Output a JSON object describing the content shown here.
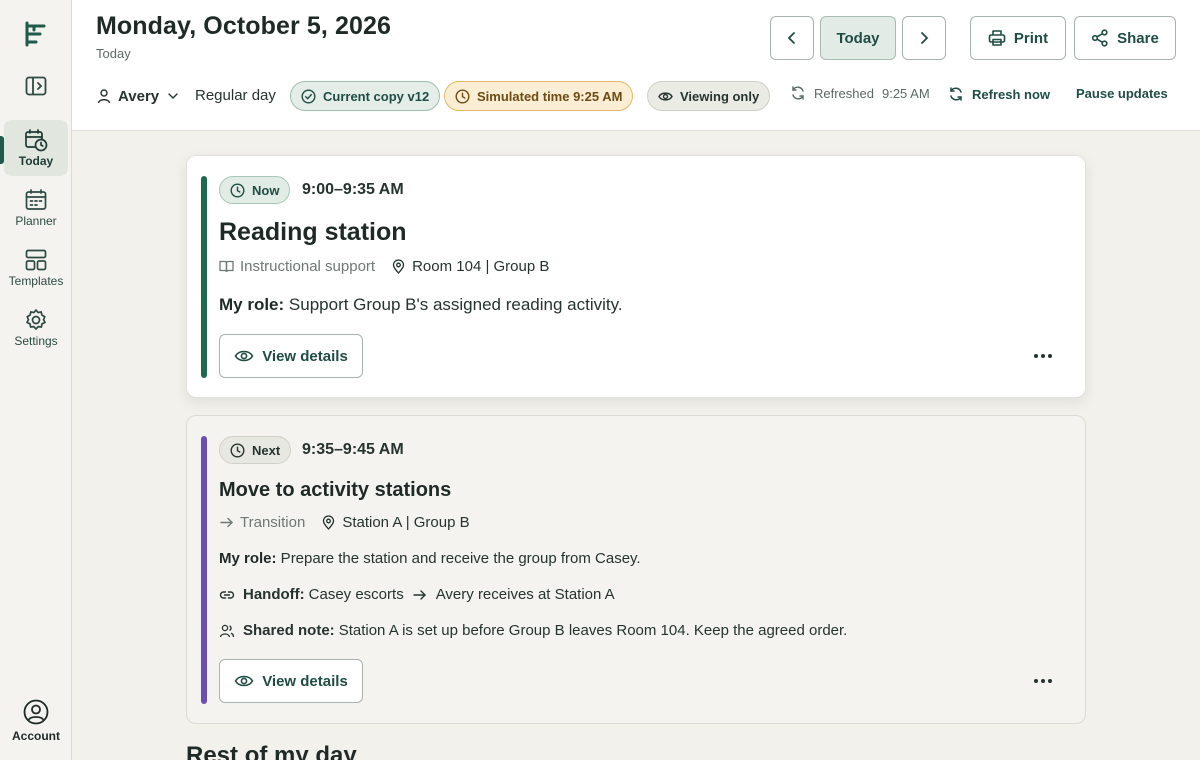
{
  "sidebar": {
    "items": [
      {
        "label": "Today",
        "icon": "calendar-clock-icon"
      },
      {
        "label": "Planner",
        "icon": "calendar-icon"
      },
      {
        "label": "Templates",
        "icon": "layout-icon"
      },
      {
        "label": "Settings",
        "icon": "gear-icon"
      }
    ],
    "account_label": "Account"
  },
  "header": {
    "date": "Monday, October 5, 2026",
    "subtitle": "Today",
    "today_button": "Today",
    "print_button": "Print",
    "share_button": "Share",
    "user_name": "Avery",
    "day_type": "Regular day",
    "copy_pill": "Current copy v12",
    "sim_pill": "Simulated time 9:25 AM",
    "view_pill": "Viewing only",
    "refreshed_label": "Refreshed",
    "refreshed_time": "9:25 AM",
    "refresh_now": "Refresh now",
    "pause_updates": "Pause updates"
  },
  "colors": {
    "accent": "#1f5a4a",
    "now_bar": "#1f6a4e",
    "next_bar": "#6a4fb0",
    "sim_bg": "#fbeed5"
  },
  "cards": [
    {
      "badge": "Now",
      "time": "9:00–9:35 AM",
      "title": "Reading station",
      "category": "Instructional support",
      "location": "Room 104 | Group B",
      "role_label": "My role:",
      "role_text": " Support Group B's assigned reading activity.",
      "button": "View details"
    },
    {
      "badge": "Next",
      "time": "9:35–9:45 AM",
      "title": "Move to activity stations",
      "category": "Transition",
      "location": "Station A | Group B",
      "role_label": "My role:",
      "role_text": " Prepare the station and receive the group from Casey.",
      "handoff_label": "Handoff:",
      "handoff_from": "Casey escorts",
      "handoff_to": "Avery receives at Station A",
      "note_label": "Shared note:",
      "note_text": "Station A is set up before Group B leaves Room 104. Keep the agreed order.",
      "button": "View details"
    }
  ],
  "rest_title": "Rest of my day"
}
